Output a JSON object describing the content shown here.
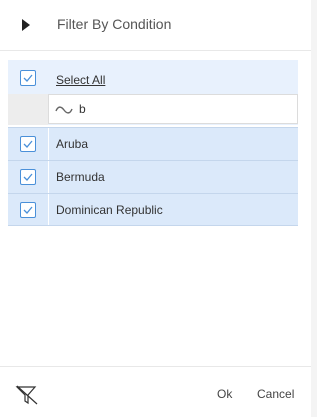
{
  "header": {
    "title": "Filter By Condition"
  },
  "filter": {
    "select_all_label": "Select All",
    "search_value": "b",
    "items": [
      {
        "label": "Aruba",
        "checked": true
      },
      {
        "label": "Bermuda",
        "checked": true
      },
      {
        "label": "Dominican Republic",
        "checked": true
      }
    ]
  },
  "footer": {
    "ok_label": "Ok",
    "cancel_label": "Cancel"
  },
  "colors": {
    "accent": "#4a90d9",
    "row_bg": "#dbe9fa"
  }
}
